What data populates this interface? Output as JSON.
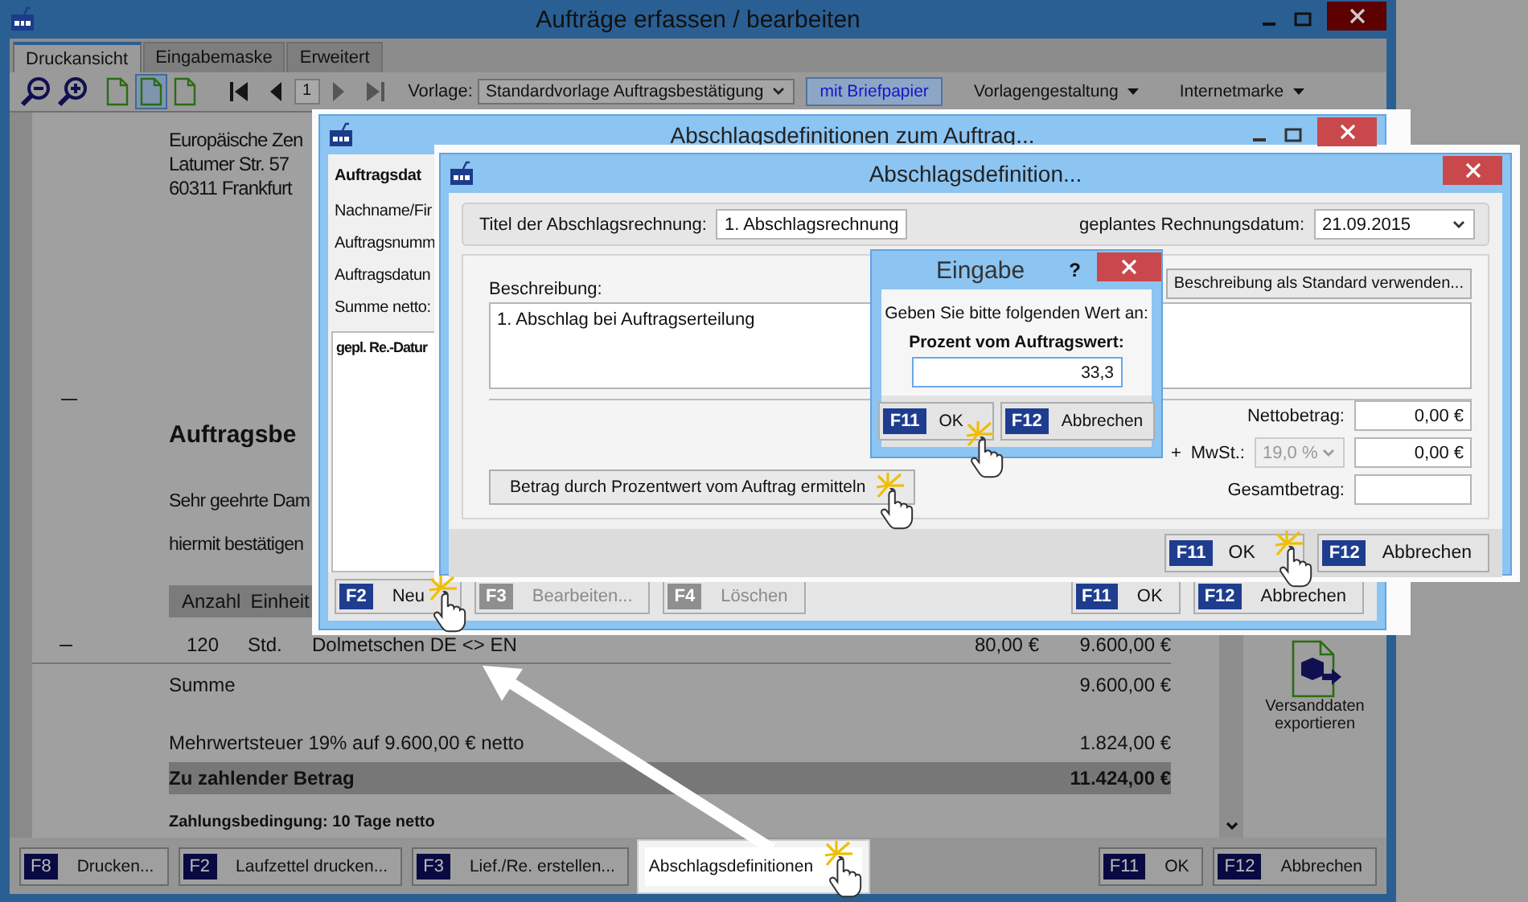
{
  "main_window": {
    "title": "Aufträge erfassen / bearbeiten",
    "tabs": [
      {
        "label": "Druckansicht",
        "selected": true
      },
      {
        "label": "Eingabemaske",
        "selected": false
      },
      {
        "label": "Erweitert",
        "selected": false
      }
    ],
    "toolbar": {
      "view_modes": [
        {
          "selected": false
        },
        {
          "selected": true
        },
        {
          "selected": false
        }
      ],
      "page": "1",
      "template_label": "Vorlage:",
      "template": "Standardvorlage Auftragsbestätigung",
      "letterhead_button": "mit Briefpapier",
      "menus": [
        "Vorlagengestaltung",
        "Internetmarke"
      ]
    },
    "document": {
      "address": [
        "Europäische Zen",
        "Latumer Str. 57",
        "60311 Frankfurt"
      ],
      "heading": "Auftragsbe",
      "salutation": "Sehr geehrte Dam",
      "intro": "hiermit bestätigen",
      "columns": [
        "Anzahl",
        "Einheit"
      ],
      "item": {
        "quantity": "120",
        "unit": "Std.",
        "description": "Dolmetschen DE <> EN",
        "price": "80,00 €",
        "amount": "9.600,00 €"
      },
      "sum": {
        "label": "Summe",
        "value": "9.600,00 €"
      },
      "vat": {
        "label": "Mehrwertsteuer 19% auf 9.600,00 € netto",
        "value": "1.824,00 €"
      },
      "total": {
        "label": "Zu zahlender Betrag",
        "value": "11.424,00 €"
      },
      "terms": "Zahlungsbedingung: 10 Tage netto"
    },
    "side_action": "Versanddaten exportieren",
    "buttons": [
      {
        "key": "F8",
        "label": "Drucken...",
        "highlighted": false
      },
      {
        "key": "F2",
        "label": "Laufzettel drucken...",
        "highlighted": false
      },
      {
        "key": "F3",
        "label": "Lief./Re. erstellen...",
        "highlighted": false
      },
      {
        "label": "Abschlagsdefinitionen",
        "highlighted": true
      }
    ],
    "confirm_buttons": [
      {
        "key": "F11",
        "label": "OK"
      },
      {
        "key": "F12",
        "label": "Abbrechen"
      }
    ]
  },
  "dialog_list": {
    "title": "Abschlagsdefinitionen zum Auftrag...",
    "section": "Auftragsdat",
    "labels": [
      "Nachname/Fir",
      "Auftragsnumm",
      "Auftragsdatun",
      "Summe netto:"
    ],
    "list_column": "gepl. Re.-Datur",
    "buttons": [
      {
        "key": "F2",
        "label": "Neu",
        "disabled": false
      },
      {
        "key": "F3",
        "label": "Bearbeiten...",
        "disabled": true
      },
      {
        "key": "F4",
        "label": "Löschen",
        "disabled": true
      }
    ],
    "confirm_buttons": [
      {
        "key": "F11",
        "label": "OK"
      },
      {
        "key": "F12",
        "label": "Abbrechen"
      }
    ]
  },
  "dialog_edit": {
    "title": "Abschlagsdefinition...",
    "invoice_title_label": "Titel der Abschlagsrechnung:",
    "invoice_title": "1. Abschlagsrechnung",
    "date_label": "geplantes Rechnungsdatum:",
    "date": "21.09.2015",
    "description_label": "Beschreibung:",
    "description": "1. Abschlag bei Auftragserteilung",
    "standard_button": "Beschreibung als Standard verwenden...",
    "percent_button": "Betrag durch Prozentwert vom Auftrag ermitteln",
    "net_label": "Nettobetrag:",
    "net": "0,00 €",
    "vat_prefix": "+",
    "vat_label": "MwSt.:",
    "vat_rate": {
      "value": "19,0 %",
      "disabled": true
    },
    "vat": "0,00 €",
    "gross_label": "Gesamtbetrag:",
    "confirm_buttons": [
      {
        "key": "F11",
        "label": "OK"
      },
      {
        "key": "F12",
        "label": "Abbrechen"
      }
    ]
  },
  "dialog_input": {
    "title": "Eingabe",
    "help": "?",
    "prompt": "Geben Sie bitte folgenden Wert an:",
    "field_label": "Prozent vom Auftragswert:",
    "value": "33,3",
    "confirm_buttons": [
      {
        "key": "F11",
        "label": "OK"
      },
      {
        "key": "F12",
        "label": "Abbrechen"
      }
    ]
  }
}
